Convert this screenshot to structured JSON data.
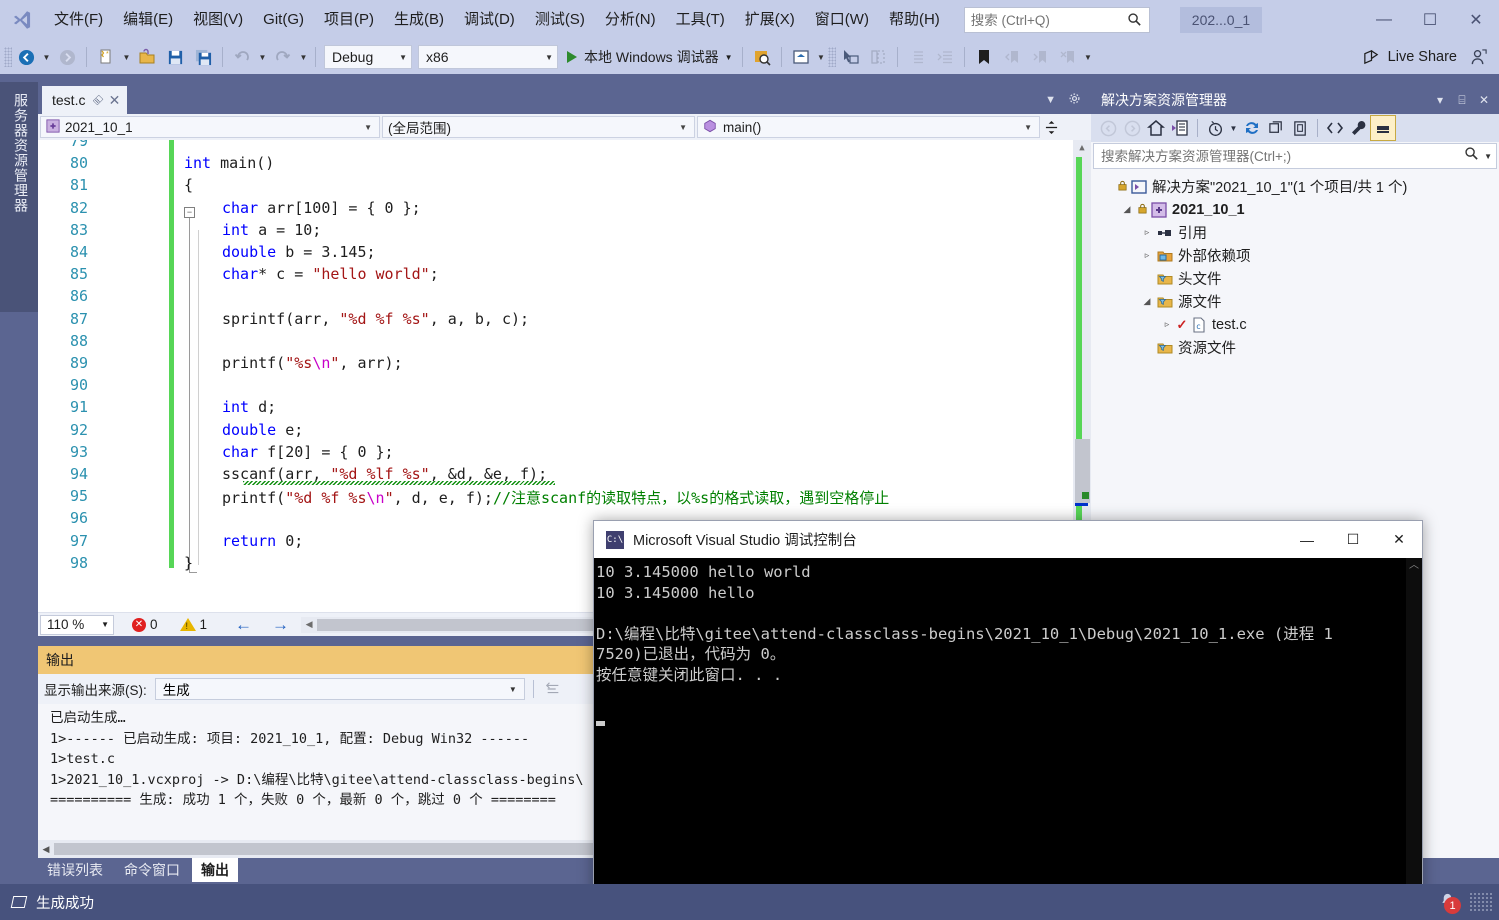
{
  "titlebar": {
    "menu_items": [
      "文件(F)",
      "编辑(E)",
      "视图(V)",
      "Git(G)",
      "项目(P)",
      "生成(B)",
      "调试(D)",
      "测试(S)",
      "分析(N)",
      "工具(T)",
      "扩展(X)",
      "窗口(W)",
      "帮助(H)"
    ],
    "search_placeholder": "搜索 (Ctrl+Q)",
    "search_value": "",
    "document_title": "202...0_1",
    "minimize_label": "—",
    "maximize_label": "☐",
    "close_label": "✕"
  },
  "toolbar": {
    "configuration": "Debug",
    "platform": "x86",
    "run_label": "本地 Windows 调试器",
    "live_share_label": "Live Share"
  },
  "left_sidebar": {
    "vertical_tab": "服务器资源管理器"
  },
  "editor": {
    "tab_name": "test.c",
    "tab_pin": "⌸",
    "tab_close": "✕",
    "scope_project": "2021_10_1",
    "scope_namespace": "(全局范围)",
    "scope_function": "main()",
    "zoom": "110 %",
    "error_count": "0",
    "warning_count": "1",
    "code_lines": [
      {
        "num": "79",
        "indent": 0,
        "html": "",
        "partial": true
      },
      {
        "num": "80",
        "indent": 0,
        "html": "<span class='kw'>int</span> main()"
      },
      {
        "num": "81",
        "indent": 0,
        "html": "{"
      },
      {
        "num": "82",
        "indent": 1,
        "html": "<span class='kw'>char</span> arr[100] = { 0 };"
      },
      {
        "num": "83",
        "indent": 1,
        "html": "<span class='kw'>int</span> a = 10;"
      },
      {
        "num": "84",
        "indent": 1,
        "html": "<span class='kw'>double</span> b = 3.145;"
      },
      {
        "num": "85",
        "indent": 1,
        "html": "<span class='kw'>char</span>* c = <span class='str'>\"hello world\"</span>;"
      },
      {
        "num": "86",
        "indent": 1,
        "html": ""
      },
      {
        "num": "87",
        "indent": 1,
        "html": "sprintf(arr, <span class='str'>\"%d %f %s\"</span>, a, b, c);"
      },
      {
        "num": "88",
        "indent": 1,
        "html": ""
      },
      {
        "num": "89",
        "indent": 1,
        "html": "printf(<span class='str'>\"%s</span><span class='esc'>\\n</span><span class='str'>\"</span>, arr);"
      },
      {
        "num": "90",
        "indent": 1,
        "html": ""
      },
      {
        "num": "91",
        "indent": 1,
        "html": "<span class='kw'>int</span> d;"
      },
      {
        "num": "92",
        "indent": 1,
        "html": "<span class='kw'>double</span> e;"
      },
      {
        "num": "93",
        "indent": 1,
        "html": "<span class='kw'>char</span> f[20] = { 0 };"
      },
      {
        "num": "94",
        "indent": 1,
        "html": "sscanf(arr, <span class='str'>\"%d %lf %s\"</span>, &amp;d, &amp;e, f);"
      },
      {
        "num": "95",
        "indent": 1,
        "html": "printf(<span class='str'>\"%d %f %s</span><span class='esc'>\\n</span><span class='str'>\"</span>, d, e, f);<span class='cmt'>//注意scanf的读取特点，以%s的格式读取，遇到空格停止</span>"
      },
      {
        "num": "96",
        "indent": 1,
        "html": ""
      },
      {
        "num": "97",
        "indent": 1,
        "html": "<span class='kw'>return</span> 0;"
      },
      {
        "num": "98",
        "indent": 0,
        "html": "}"
      }
    ]
  },
  "output": {
    "panel_title": "输出",
    "source_label": "显示输出来源(S):",
    "source_value": "生成",
    "lines": [
      "已启动生成…",
      "1>------ 已启动生成: 项目: 2021_10_1, 配置: Debug Win32 ------",
      "1>test.c",
      "1>2021_10_1.vcxproj -> D:\\编程\\比特\\gitee\\attend-classclass-begins\\",
      "========== 生成: 成功 1 个，失败 0 个，最新 0 个，跳过 0 个 ========"
    ]
  },
  "bottom_tabs": [
    {
      "label": "错误列表",
      "active": false
    },
    {
      "label": "命令窗口",
      "active": false
    },
    {
      "label": "输出",
      "active": true
    }
  ],
  "solution_explorer": {
    "title": "解决方案资源管理器",
    "dropdown_icon": "▾",
    "pin_icon": "⌸",
    "close_icon": "✕",
    "search_placeholder": "搜索解决方案资源管理器(Ctrl+;)",
    "search_value": "",
    "tree": [
      {
        "label": "解决方案\"2021_10_1\"(1 个项目/共 1 个)",
        "level": 0,
        "twisty": "",
        "icon": "solution-icon",
        "lock": true,
        "bold": false,
        "check": false
      },
      {
        "label": "2021_10_1",
        "level": 1,
        "twisty": "◢",
        "icon": "project-icon",
        "lock": true,
        "bold": true,
        "check": false
      },
      {
        "label": "引用",
        "level": 2,
        "twisty": "▹",
        "icon": "references-icon",
        "lock": false,
        "bold": false,
        "check": false
      },
      {
        "label": "外部依赖项",
        "level": 2,
        "twisty": "▹",
        "icon": "external-deps-icon",
        "lock": false,
        "bold": false,
        "check": false
      },
      {
        "label": "头文件",
        "level": 2,
        "twisty": "",
        "icon": "filter-folder-icon",
        "lock": false,
        "bold": false,
        "check": false
      },
      {
        "label": "源文件",
        "level": 2,
        "twisty": "◢",
        "icon": "filter-folder-icon",
        "lock": false,
        "bold": false,
        "check": false
      },
      {
        "label": "test.c",
        "level": 3,
        "twisty": "▹",
        "icon": "c-file-icon",
        "lock": false,
        "bold": false,
        "check": true
      },
      {
        "label": "资源文件",
        "level": 2,
        "twisty": "",
        "icon": "filter-folder-icon",
        "lock": false,
        "bold": false,
        "check": false
      }
    ]
  },
  "console_window": {
    "title": "Microsoft Visual Studio 调试控制台",
    "icon_text": "C:\\",
    "minimize_label": "—",
    "maximize_label": "☐",
    "close_label": "✕",
    "lines": [
      "10 3.145000 hello world",
      "10 3.145000 hello",
      "",
      "D:\\编程\\比特\\gitee\\attend-classclass-begins\\2021_10_1\\Debug\\2021_10_1.exe (进程 1",
      "7520)已退出，代码为 0。",
      "按任意键关闭此窗口. . ."
    ]
  },
  "statusbar": {
    "message": "生成成功",
    "notification_count": "1"
  },
  "colors": {
    "chrome": "#c5cde8",
    "accent_dark": "#5b6591",
    "status_bar": "#47527d",
    "output_header": "#f0c674",
    "change_bar_green": "#57d657",
    "keyword_blue": "#0000ff",
    "string_red": "#a31515",
    "comment_green": "#008000",
    "linenum_teal": "#2b91af"
  }
}
